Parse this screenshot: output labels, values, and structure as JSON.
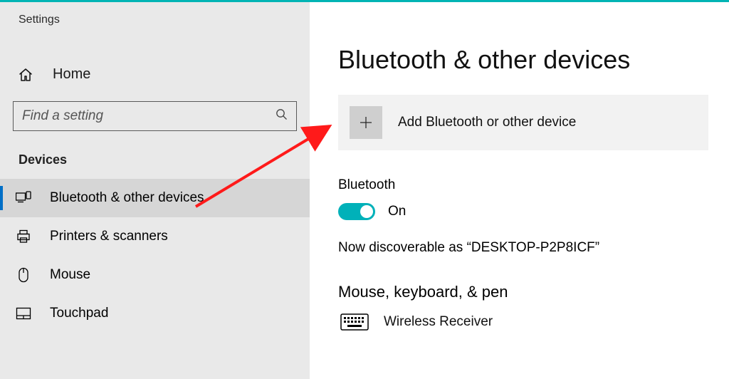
{
  "window": {
    "title": "Settings"
  },
  "sidebar": {
    "home_label": "Home",
    "search_placeholder": "Find a setting",
    "section_header": "Devices",
    "items": [
      {
        "label": "Bluetooth & other devices"
      },
      {
        "label": "Printers & scanners"
      },
      {
        "label": "Mouse"
      },
      {
        "label": "Touchpad"
      }
    ]
  },
  "content": {
    "page_title": "Bluetooth & other devices",
    "add_device_label": "Add Bluetooth or other device",
    "bluetooth_header": "Bluetooth",
    "toggle_state": "On",
    "discoverable_text": "Now discoverable as “DESKTOP-P2P8ICF”",
    "group_header": "Mouse, keyboard, & pen",
    "devices": [
      {
        "name": "Wireless Receiver"
      }
    ]
  }
}
